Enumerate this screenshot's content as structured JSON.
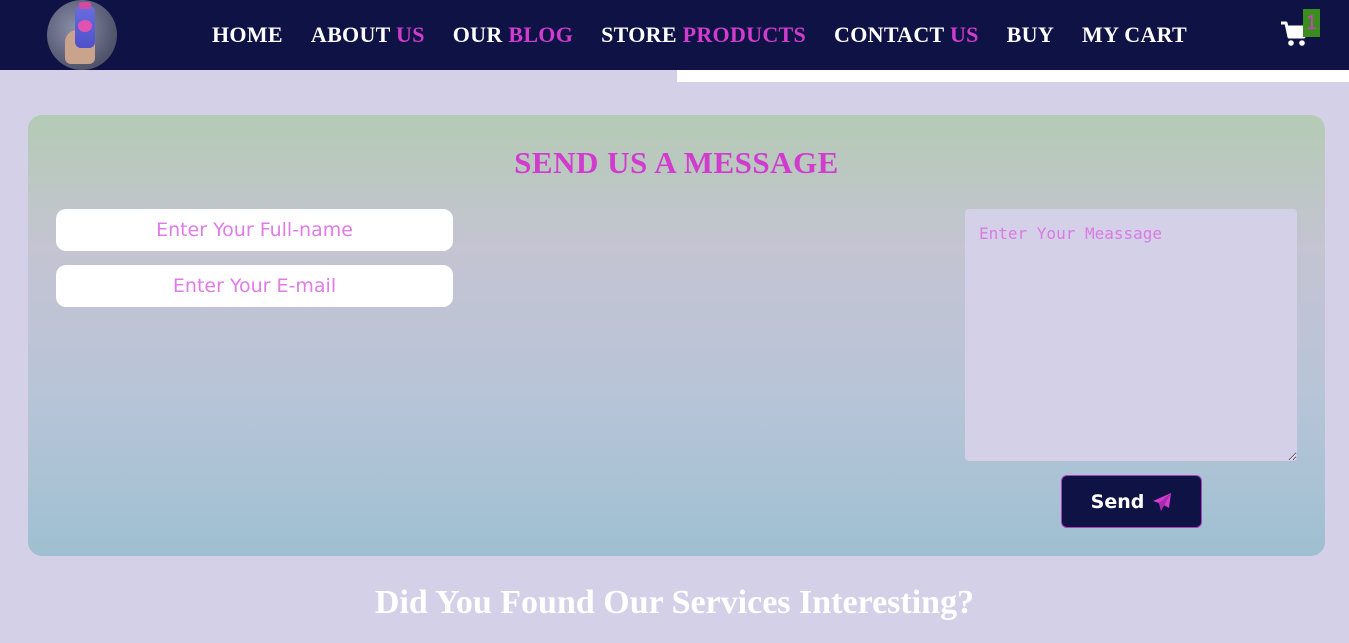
{
  "nav": {
    "logo_alt": "product logo",
    "items": [
      {
        "main": "HOME",
        "accent": ""
      },
      {
        "main": "ABOUT ",
        "accent": "US"
      },
      {
        "main": "OUR ",
        "accent": "BLOG"
      },
      {
        "main": "STORE ",
        "accent": "PRODUCTS"
      },
      {
        "main": "CONTACT ",
        "accent": "US"
      },
      {
        "main": "BUY",
        "accent": ""
      },
      {
        "main": "MY CART",
        "accent": ""
      }
    ],
    "cart_icon": "shopping-cart-icon",
    "cart_count": "1"
  },
  "form": {
    "title": "SEND US A MESSAGE",
    "name_placeholder": "Enter Your Full-name",
    "email_placeholder": "Enter Your E-mail",
    "message_placeholder": "Enter Your Meassage",
    "send_label": "Send",
    "send_icon": "paper-plane-icon"
  },
  "footer": {
    "question": "Did You Found Our Services Interesting?"
  },
  "colors": {
    "navbar_bg": "#0f1245",
    "accent": "#d13ccf",
    "page_bg": "#d4d0e8",
    "cart_badge_bg": "#3b8d1d"
  }
}
